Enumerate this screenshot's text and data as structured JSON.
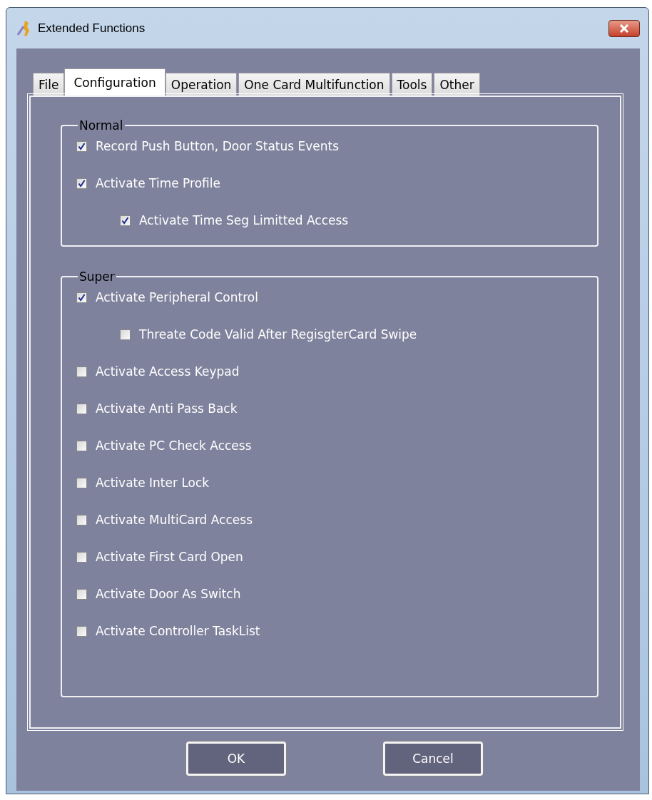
{
  "window": {
    "title": "Extended Functions"
  },
  "tabs": [
    {
      "label": "File",
      "selected": false
    },
    {
      "label": "Configuration",
      "selected": true
    },
    {
      "label": "Operation",
      "selected": false
    },
    {
      "label": "One Card Multifunction",
      "selected": false
    },
    {
      "label": "Tools",
      "selected": false
    },
    {
      "label": "Other",
      "selected": false
    }
  ],
  "groups": [
    {
      "title": "Normal",
      "items": [
        {
          "label": "Record Push Button, Door Status Events",
          "checked": true
        },
        {
          "label": "Activate Time Profile",
          "checked": true,
          "children": [
            {
              "label": "Activate Time Seg Limitted Access",
              "checked": true
            }
          ]
        }
      ]
    },
    {
      "title": "Super",
      "items": [
        {
          "label": "Activate Peripheral Control",
          "checked": true,
          "children": [
            {
              "label": "Threate Code Valid After RegisgterCard Swipe",
              "checked": false
            }
          ]
        },
        {
          "label": "Activate Access Keypad",
          "checked": false
        },
        {
          "label": "Activate Anti Pass Back",
          "checked": false
        },
        {
          "label": "Activate PC Check Access",
          "checked": false
        },
        {
          "label": "Activate Inter Lock",
          "checked": false
        },
        {
          "label": "Activate MultiCard Access",
          "checked": false
        },
        {
          "label": "Activate First Card Open",
          "checked": false
        },
        {
          "label": "Activate Door As Switch",
          "checked": false
        },
        {
          "label": "Activate Controller TaskList",
          "checked": false
        }
      ]
    }
  ],
  "buttons": [
    "OK",
    "Cancel"
  ]
}
